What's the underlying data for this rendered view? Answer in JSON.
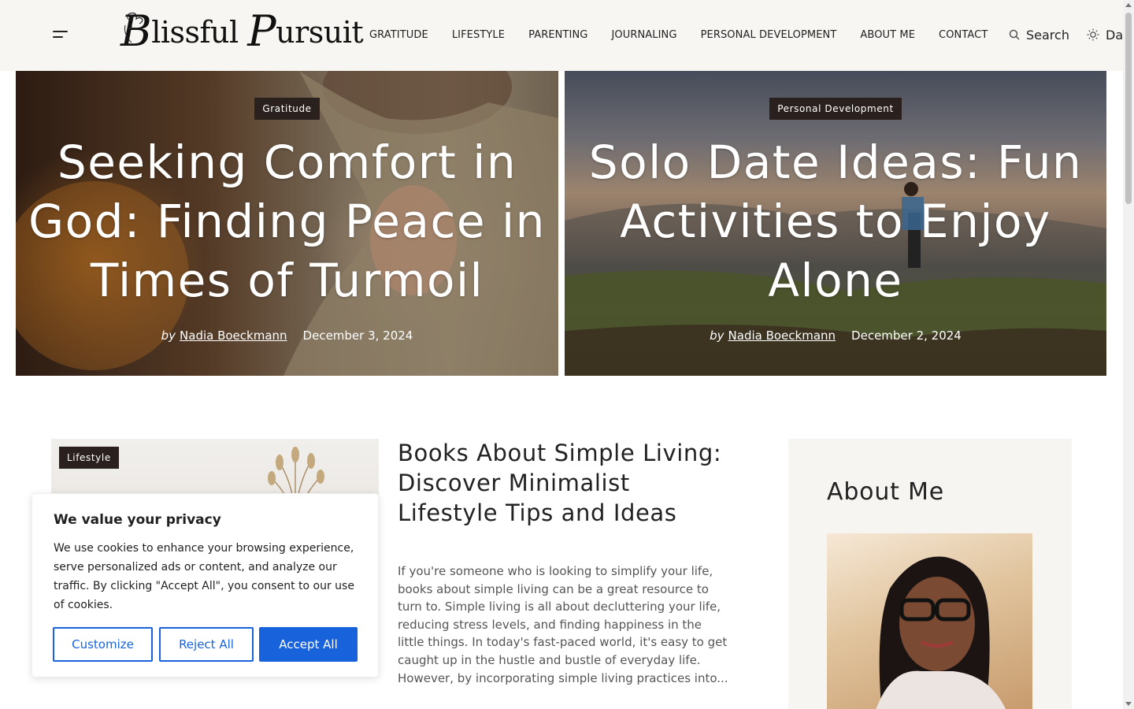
{
  "header": {
    "logo_text_1": "B",
    "logo_text_2": "lissful ",
    "logo_text_3": "P",
    "logo_text_4": "ursuit",
    "nav": [
      "GRATITUDE",
      "LIFESTYLE",
      "PARENTING",
      "JOURNALING",
      "PERSONAL DEVELOPMENT",
      "ABOUT ME",
      "CONTACT"
    ],
    "search_label": "Search",
    "theme_label": "Dark"
  },
  "hero": [
    {
      "category": "Gratitude",
      "title": "Seeking Comfort in God: Finding Peace in Times of Turmoil",
      "by": "by",
      "author": "Nadia Boeckmann",
      "date": "December 3, 2024"
    },
    {
      "category": "Personal Development",
      "title": "Solo Date Ideas: Fun Activities to Enjoy Alone",
      "by": "by",
      "author": "Nadia Boeckmann",
      "date": "December 2, 2024"
    }
  ],
  "post": {
    "category": "Lifestyle",
    "title": "Books About Simple Living: Discover Minimalist Lifestyle Tips and Ideas",
    "excerpt": "If you're someone who is looking to simplify your life, books about simple living can be a great resource to turn to. Simple living is all about decluttering your life, reducing stress levels, and finding happiness in the little things. In today's fast-paced world, it's easy to get caught up in the hustle and bustle of everyday life. However, by incorporating simple living practices into..."
  },
  "sidebar": {
    "title": "About Me"
  },
  "cookie": {
    "title": "We value your privacy",
    "text": "We use cookies to enhance your browsing experience, serve personalized ads or content, and analyze our traffic. By clicking \"Accept All\", you consent to our use of cookies.",
    "customize": "Customize",
    "reject": "Reject All",
    "accept": "Accept All"
  },
  "colors": {
    "accent": "#1863dc",
    "badge_bg": "#2a211e",
    "header_bg": "#f7f6f3",
    "sidebar_bg": "#f6f5f2"
  }
}
